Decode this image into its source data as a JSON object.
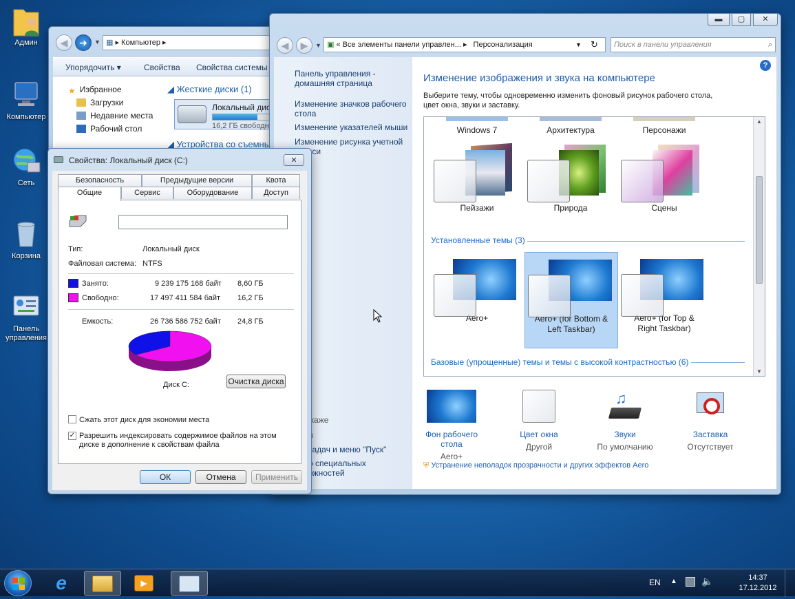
{
  "desktop": {
    "icons": [
      {
        "label": "Админ"
      },
      {
        "label": "Компьютер"
      },
      {
        "label": "Сеть"
      },
      {
        "label": "Корзина"
      },
      {
        "label": "Панель управления"
      }
    ]
  },
  "explorer": {
    "address": "Компьютер",
    "toolbar": [
      "Упорядочить",
      "Свойства",
      "Свойства системы"
    ],
    "nav": [
      "Избранное",
      "Загрузки",
      "Недавние места",
      "Рабочий стол"
    ],
    "group_hard_disks": "Жесткие диски (1)",
    "drive_name": "Локальный диск",
    "drive_free": "16,2 ГБ свободно",
    "group_removable": "Устройства со съемны"
  },
  "cpanel": {
    "breadcrumb": "« Все элементы панели управлен...",
    "breadcrumb_current": "Персонализация",
    "search_placeholder": "Поиск в панели управления",
    "left_links": [
      "Панель управления - домашняя страница",
      "Изменение значков рабочего стола",
      "Изменение указателей мыши",
      "Изменение рисунка учетной записи"
    ],
    "left_bottom": [
      "жаже",
      "н",
      "задач и меню \"Пуск\"",
      "р специальных ожностей"
    ],
    "title": "Изменение изображения и звука на компьютере",
    "description": "Выберите тему, чтобы одновременно изменить фоновый рисунок рабочего стола, цвет окна, звуки и заставку.",
    "top_themes": [
      "Windows 7",
      "Архитектура",
      "Персонажи"
    ],
    "themes_row": [
      "Пейзажи",
      "Природа",
      "Сцены"
    ],
    "installed_header": "Установленные темы (3)",
    "installed_themes": [
      "Aero+",
      "Aero+ (for Bottom & Left Taskbar)",
      "Aero+ (for Top & Right Taskbar)"
    ],
    "basic_header": "Базовые (упрощенные) темы и темы с высокой контрастностью (6)",
    "bottom_items": [
      {
        "label": "Фон рабочего стола",
        "sub": "Aero+"
      },
      {
        "label": "Цвет окна",
        "sub": "Другой"
      },
      {
        "label": "Звуки",
        "sub": "По умолчанию"
      },
      {
        "label": "Заставка",
        "sub": "Отсутствует"
      }
    ],
    "troubleshoot": "Устранение неполадок прозрачности и других эффектов Aero"
  },
  "props": {
    "title": "Свойства: Локальный диск (C:)",
    "tabs_top": [
      "Безопасность",
      "Предыдущие версии",
      "Квота"
    ],
    "tabs_bottom": [
      "Общие",
      "Сервис",
      "Оборудование",
      "Доступ"
    ],
    "name_value": "",
    "type_label": "Тип:",
    "type_value": "Локальный диск",
    "fs_label": "Файловая система:",
    "fs_value": "NTFS",
    "used_label": "Занято:",
    "used_bytes": "9 239 175 168 байт",
    "used_gb": "8,60 ГБ",
    "free_label": "Свободно:",
    "free_bytes": "17 497 411 584 байт",
    "free_gb": "16,2 ГБ",
    "cap_label": "Емкость:",
    "cap_bytes": "26 736 586 752 байт",
    "cap_gb": "24,8 ГБ",
    "disk_label": "Диск C:",
    "cleanup": "Очистка диска",
    "compress": "Сжать этот диск для экономии места",
    "index": "Разрешить индексировать содержимое файлов на этом диске в дополнение к свойствам файла",
    "ok": "ОК",
    "cancel": "Отмена",
    "apply": "Применить",
    "used_fraction": 0.3456,
    "colors": {
      "used": "#1010e8",
      "free": "#f010f0"
    }
  },
  "taskbar": {
    "lang": "EN",
    "time": "14:37",
    "date": "17.12.2012"
  }
}
